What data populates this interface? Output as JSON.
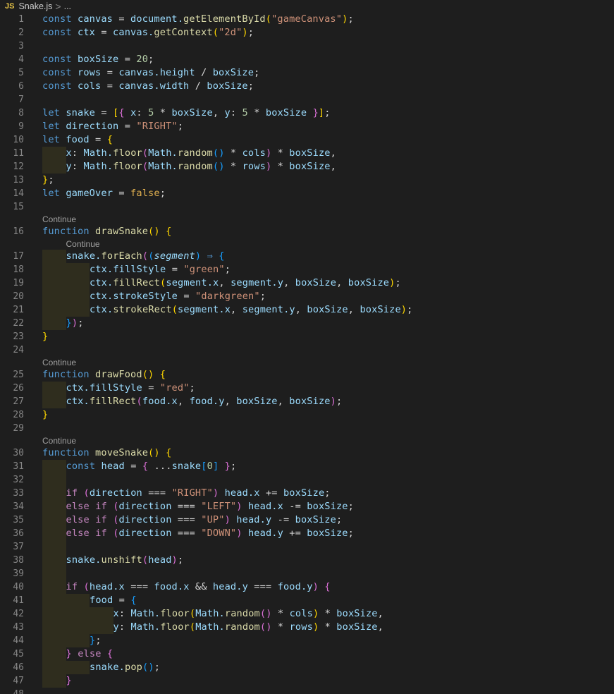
{
  "breadcrumb": {
    "file_badge": "JS",
    "file_name": "Snake.js",
    "separator": ">",
    "more": "..."
  },
  "codelens": {
    "label": "Continue"
  },
  "lines": [
    {
      "n": "1",
      "html": "<span class='kw'>const</span> canvas <span class='op'>=</span> document.<span class='fn'>getElementById</span><span class='p1'>(</span><span class='str'>\"gameCanvas\"</span><span class='p1'>)</span><span class='op'>;</span>"
    },
    {
      "n": "2",
      "html": "<span class='kw'>const</span> ctx <span class='op'>=</span> canvas.<span class='fn'>getContext</span><span class='p1'>(</span><span class='str'>\"2d\"</span><span class='p1'>)</span><span class='op'>;</span>"
    },
    {
      "n": "3",
      "html": ""
    },
    {
      "n": "4",
      "html": "<span class='kw'>const</span> boxSize <span class='op'>=</span> <span class='num'>20</span><span class='op'>;</span>"
    },
    {
      "n": "5",
      "html": "<span class='kw'>const</span> rows <span class='op'>=</span> canvas.height <span class='op'>/</span> boxSize<span class='op'>;</span>"
    },
    {
      "n": "6",
      "html": "<span class='kw'>const</span> cols <span class='op'>=</span> canvas.width <span class='op'>/</span> boxSize<span class='op'>;</span>"
    },
    {
      "n": "7",
      "html": ""
    },
    {
      "n": "8",
      "html": "<span class='kw'>let</span> snake <span class='op'>=</span> <span class='p1'>[</span><span class='p2'>{</span> x<span class='op'>:</span> <span class='num'>5</span> <span class='op'>*</span> boxSize<span class='op'>,</span> y<span class='op'>:</span> <span class='num'>5</span> <span class='op'>*</span> boxSize <span class='p2'>}</span><span class='p1'>]</span><span class='op'>;</span>"
    },
    {
      "n": "9",
      "html": "<span class='kw'>let</span> direction <span class='op'>=</span> <span class='str'>\"RIGHT\"</span><span class='op'>;</span>"
    },
    {
      "n": "10",
      "html": "<span class='kw'>let</span> food <span class='op'>=</span> <span class='p1'>{</span>"
    },
    {
      "n": "11",
      "ind": 1,
      "html": "x<span class='op'>:</span> Math.<span class='fn'>floor</span><span class='p2'>(</span>Math.<span class='fn'>random</span><span class='p3'>()</span> <span class='op'>*</span> cols<span class='p2'>)</span> <span class='op'>*</span> boxSize<span class='op'>,</span>"
    },
    {
      "n": "12",
      "ind": 1,
      "html": "y<span class='op'>:</span> Math.<span class='fn'>floor</span><span class='p2'>(</span>Math.<span class='fn'>random</span><span class='p3'>()</span> <span class='op'>*</span> rows<span class='p2'>)</span> <span class='op'>*</span> boxSize<span class='op'>,</span>"
    },
    {
      "n": "13",
      "html": "<span class='p1'>}</span><span class='op'>;</span>"
    },
    {
      "n": "14",
      "html": "<span class='kw'>let</span> gameOver <span class='op'>=</span> <span class='bool'>false</span><span class='op'>;</span>"
    },
    {
      "n": "15",
      "html": ""
    },
    {
      "lens": 0
    },
    {
      "n": "16",
      "html": "<span class='kw'>function</span> <span class='fn'>drawSnake</span><span class='p1'>()</span> <span class='p1'>{</span>"
    },
    {
      "lens": 1
    },
    {
      "n": "17",
      "ind": 1,
      "html": "snake.<span class='fn'>forEach</span><span class='p2'>(</span><span class='p3'>(</span><span class='it'>segment</span><span class='p3'>)</span> <span class='kw'>⇒</span> <span class='p3'>{</span>"
    },
    {
      "n": "18",
      "ind": 2,
      "html": "ctx.fillStyle <span class='op'>=</span> <span class='str'>\"green\"</span><span class='op'>;</span>"
    },
    {
      "n": "19",
      "ind": 2,
      "html": "ctx.<span class='fn'>fillRect</span><span class='p1'>(</span>segment.x<span class='op'>,</span> segment.y<span class='op'>,</span> boxSize<span class='op'>,</span> boxSize<span class='p1'>)</span><span class='op'>;</span>"
    },
    {
      "n": "20",
      "ind": 2,
      "html": "ctx.strokeStyle <span class='op'>=</span> <span class='str'>\"darkgreen\"</span><span class='op'>;</span>"
    },
    {
      "n": "21",
      "ind": 2,
      "html": "ctx.<span class='fn'>strokeRect</span><span class='p1'>(</span>segment.x<span class='op'>,</span> segment.y<span class='op'>,</span> boxSize<span class='op'>,</span> boxSize<span class='p1'>)</span><span class='op'>;</span>"
    },
    {
      "n": "22",
      "ind": 1,
      "html": "<span class='p3'>}</span><span class='p2'>)</span><span class='op'>;</span>"
    },
    {
      "n": "23",
      "html": "<span class='p1'>}</span>"
    },
    {
      "n": "24",
      "html": ""
    },
    {
      "lens": 0
    },
    {
      "n": "25",
      "html": "<span class='kw'>function</span> <span class='fn'>drawFood</span><span class='p1'>()</span> <span class='p1'>{</span>"
    },
    {
      "n": "26",
      "ind": 1,
      "html": "ctx.fillStyle <span class='op'>=</span> <span class='str'>\"red\"</span><span class='op'>;</span>"
    },
    {
      "n": "27",
      "ind": 1,
      "html": "ctx.<span class='fn'>fillRect</span><span class='p2'>(</span>food.x<span class='op'>,</span> food.y<span class='op'>,</span> boxSize<span class='op'>,</span> boxSize<span class='p2'>)</span><span class='op'>;</span>"
    },
    {
      "n": "28",
      "html": "<span class='p1'>}</span>"
    },
    {
      "n": "29",
      "html": ""
    },
    {
      "lens": 0
    },
    {
      "n": "30",
      "html": "<span class='kw'>function</span> <span class='fn'>moveSnake</span><span class='p1'>()</span> <span class='p1'>{</span>"
    },
    {
      "n": "31",
      "ind": 1,
      "html": "<span class='kw'>const</span> head <span class='op'>=</span> <span class='p2'>{</span> <span class='op'>...</span>snake<span class='p3'>[</span><span class='num'>0</span><span class='p3'>]</span> <span class='p2'>}</span><span class='op'>;</span>"
    },
    {
      "n": "32",
      "ind": 1,
      "html": ""
    },
    {
      "n": "33",
      "ind": 1,
      "html": "<span class='ctl'>if</span> <span class='p2'>(</span>direction <span class='op'>===</span> <span class='str'>\"RIGHT\"</span><span class='p2'>)</span> head.x <span class='op'>+=</span> boxSize<span class='op'>;</span>"
    },
    {
      "n": "34",
      "ind": 1,
      "html": "<span class='ctl'>else</span> <span class='ctl'>if</span> <span class='p2'>(</span>direction <span class='op'>===</span> <span class='str'>\"LEFT\"</span><span class='p2'>)</span> head.x <span class='op'>-=</span> boxSize<span class='op'>;</span>"
    },
    {
      "n": "35",
      "ind": 1,
      "html": "<span class='ctl'>else</span> <span class='ctl'>if</span> <span class='p2'>(</span>direction <span class='op'>===</span> <span class='str'>\"UP\"</span><span class='p2'>)</span> head.y <span class='op'>-=</span> boxSize<span class='op'>;</span>"
    },
    {
      "n": "36",
      "ind": 1,
      "html": "<span class='ctl'>else</span> <span class='ctl'>if</span> <span class='p2'>(</span>direction <span class='op'>===</span> <span class='str'>\"DOWN\"</span><span class='p2'>)</span> head.y <span class='op'>+=</span> boxSize<span class='op'>;</span>"
    },
    {
      "n": "37",
      "ind": 1,
      "html": ""
    },
    {
      "n": "38",
      "ind": 1,
      "html": "snake.<span class='fn'>unshift</span><span class='p2'>(</span>head<span class='p2'>)</span><span class='op'>;</span>"
    },
    {
      "n": "39",
      "ind": 1,
      "html": ""
    },
    {
      "n": "40",
      "ind": 1,
      "html": "<span class='ctl'>if</span> <span class='p2'>(</span>head.x <span class='op'>===</span> food.x <span class='op'>&amp;&amp;</span> head.y <span class='op'>===</span> food.y<span class='p2'>)</span> <span class='p2'>{</span>"
    },
    {
      "n": "41",
      "ind": 2,
      "html": "food <span class='op'>=</span> <span class='p3'>{</span>"
    },
    {
      "n": "42",
      "ind": 3,
      "html": "x<span class='op'>:</span> Math.<span class='fn'>floor</span><span class='p1'>(</span>Math.<span class='fn'>random</span><span class='p2'>()</span> <span class='op'>*</span> cols<span class='p1'>)</span> <span class='op'>*</span> boxSize<span class='op'>,</span>"
    },
    {
      "n": "43",
      "ind": 3,
      "html": "y<span class='op'>:</span> Math.<span class='fn'>floor</span><span class='p1'>(</span>Math.<span class='fn'>random</span><span class='p2'>()</span> <span class='op'>*</span> rows<span class='p1'>)</span> <span class='op'>*</span> boxSize<span class='op'>,</span>"
    },
    {
      "n": "44",
      "ind": 2,
      "html": "<span class='p3'>}</span><span class='op'>;</span>"
    },
    {
      "n": "45",
      "ind": 1,
      "html": "<span class='p2'>}</span> <span class='ctl'>else</span> <span class='p2'>{</span>"
    },
    {
      "n": "46",
      "ind": 2,
      "html": "snake.<span class='fn'>pop</span><span class='p3'>()</span><span class='op'>;</span>"
    },
    {
      "n": "47",
      "ind": 1,
      "html": "<span class='p2'>}</span>"
    },
    {
      "n": "48",
      "html": ""
    }
  ]
}
